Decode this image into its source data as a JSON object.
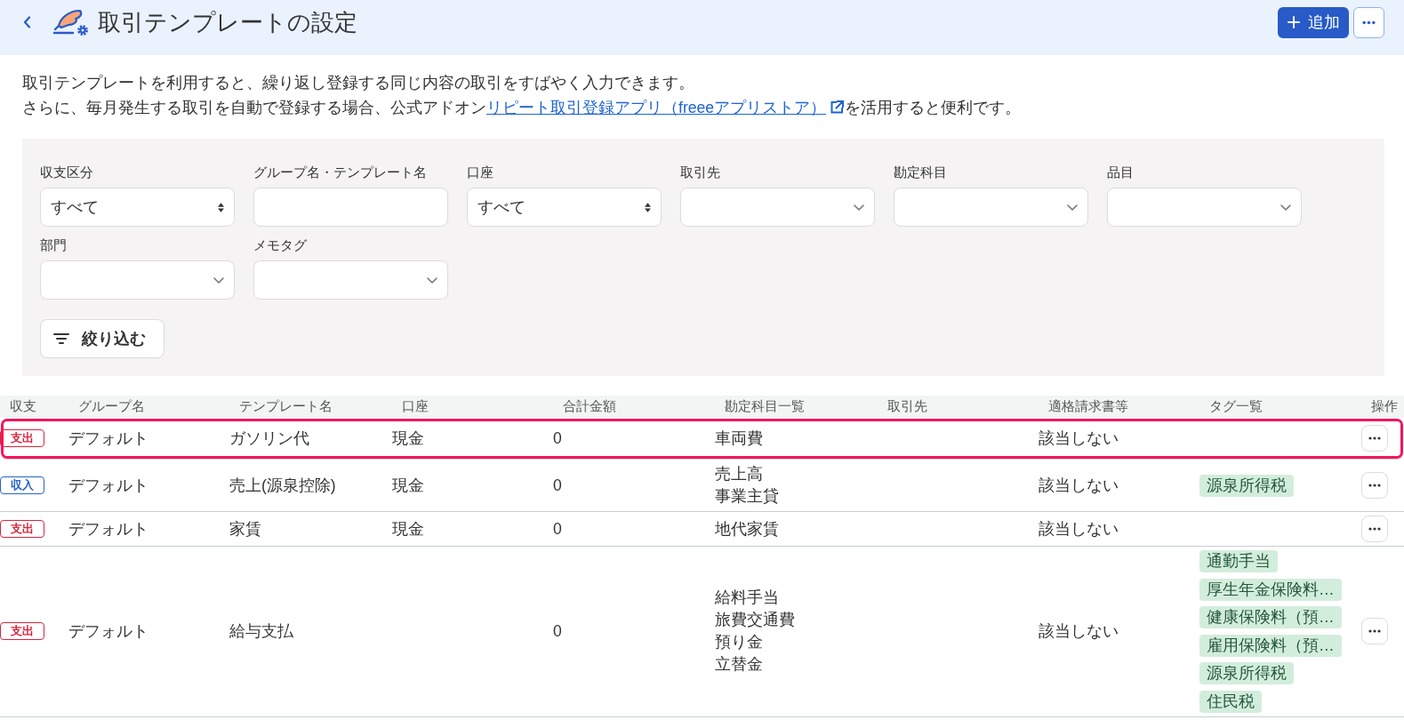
{
  "header": {
    "title": "取引テンプレートの設定",
    "add_button": "追加"
  },
  "description": {
    "line_1": "取引テンプレートを利用すると、繰り返し登録する同じ内容の取引をすばやく入力できます。",
    "line_2_before_link": "さらに、毎月発生する取引を自動で登録する場合、公式アドオン",
    "link": "リピート取引登録アプリ（freeeアプリストア）",
    "line_2_after_link": "を活用すると便利です。"
  },
  "filters": {
    "fields": [
      {
        "label": "収支区分",
        "kind": "select",
        "value": "すべて"
      },
      {
        "label": "グループ名・テンプレート名",
        "kind": "text"
      },
      {
        "label": "口座",
        "kind": "select",
        "value": "すべて"
      },
      {
        "label": "取引先",
        "kind": "combobox"
      },
      {
        "label": "勘定科目",
        "kind": "combobox"
      },
      {
        "label": "品目",
        "kind": "combobox"
      },
      {
        "label": "部門",
        "kind": "combobox"
      },
      {
        "label": "メモタグ",
        "kind": "combobox"
      }
    ],
    "apply_button": "絞り込む"
  },
  "table": {
    "columns": [
      "収支",
      "グループ名",
      "テンプレート名",
      "口座",
      "合計金額",
      "勘定科目一覧",
      "取引先",
      "適格請求書等",
      "タグ一覧",
      "操作"
    ],
    "rows": [
      {
        "type": {
          "kind": "expense",
          "label": "支出"
        },
        "group": "デフォルト",
        "template": "ガソリン代",
        "account": "現金",
        "total": "0",
        "account_items": [
          "車両費"
        ],
        "invoice": "該当しない",
        "highlighted": true
      },
      {
        "type": {
          "kind": "income",
          "label": "収入"
        },
        "group": "デフォルト",
        "template": "売上(源泉控除)",
        "account": "現金",
        "total": "0",
        "account_items": [
          "売上高",
          "事業主貸"
        ],
        "invoice": "該当しない",
        "tags": [
          "源泉所得税"
        ],
        "highlighted": false
      },
      {
        "type": {
          "kind": "expense",
          "label": "支出"
        },
        "group": "デフォルト",
        "template": "家賃",
        "account": "現金",
        "total": "0",
        "account_items": [
          "地代家賃"
        ],
        "invoice": "該当しない",
        "highlighted": false
      },
      {
        "type": {
          "kind": "expense",
          "label": "支出"
        },
        "group": "デフォルト",
        "template": "給与支払",
        "total": "0",
        "account_items": [
          "給料手当",
          "旅費交通費",
          "預り金",
          "立替金"
        ],
        "invoice": "該当しない",
        "tags": [
          "通勤手当",
          "厚生年金保険料…",
          "健康保険料（預…",
          "雇用保険料（預…",
          "源泉所得税",
          "住民税"
        ],
        "highlighted": false
      }
    ]
  }
}
